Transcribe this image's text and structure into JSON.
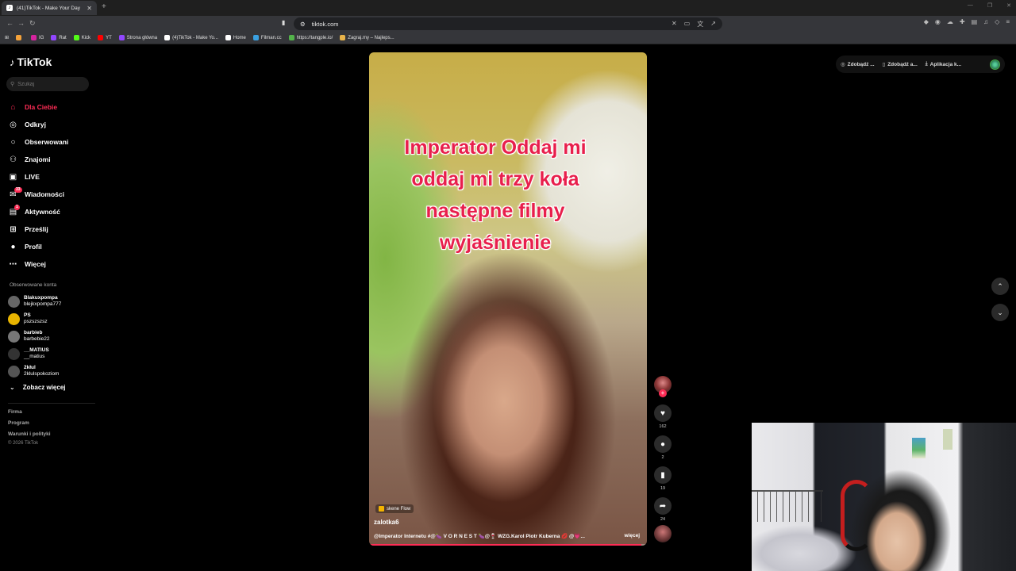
{
  "browser": {
    "tab_title": "(41)TikTok - Make Your Day",
    "url": "tiktok.com",
    "bookmarks": [
      {
        "label": "",
        "color": "#f4a23a"
      },
      {
        "label": "IG",
        "color": "#d6249f"
      },
      {
        "label": "Rat",
        "color": "#9146ff"
      },
      {
        "label": "Kick",
        "color": "#53fc18"
      },
      {
        "label": "YT",
        "color": "#ff0000"
      },
      {
        "label": "Strona główna",
        "color": "#9146ff"
      },
      {
        "label": "(4)TikTok - Make Yo...",
        "color": "#ffffff"
      },
      {
        "label": "Home",
        "color": "#ffffff"
      },
      {
        "label": "Filman.cc",
        "color": "#3aa0e0"
      },
      {
        "label": "https://tangple.io/",
        "color": "#53b34a"
      },
      {
        "label": "Zagraj.my – Najleps...",
        "color": "#e8b34a"
      }
    ]
  },
  "tiktok": {
    "logo": "TikTok",
    "search_placeholder": "Szukaj",
    "nav": [
      {
        "label": "Dla Ciebie",
        "icon": "home-icon",
        "glyph": "⌂",
        "active": true,
        "badge": ""
      },
      {
        "label": "Odkryj",
        "icon": "compass-icon",
        "glyph": "◎",
        "active": false,
        "badge": ""
      },
      {
        "label": "Obserwowani",
        "icon": "following-icon",
        "glyph": "○",
        "active": false,
        "badge": ""
      },
      {
        "label": "Znajomi",
        "icon": "friends-icon",
        "glyph": "⚇",
        "active": false,
        "badge": ""
      },
      {
        "label": "LIVE",
        "icon": "live-icon",
        "glyph": "▣",
        "active": false,
        "badge": ""
      },
      {
        "label": "Wiadomości",
        "icon": "messages-icon",
        "glyph": "✉",
        "active": false,
        "badge": "33"
      },
      {
        "label": "Aktywność",
        "icon": "activity-icon",
        "glyph": "▤",
        "active": false,
        "badge": "1"
      },
      {
        "label": "Prześlij",
        "icon": "upload-icon",
        "glyph": "⊞",
        "active": false,
        "badge": ""
      },
      {
        "label": "Profil",
        "icon": "profile-icon",
        "glyph": "●",
        "active": false,
        "badge": ""
      },
      {
        "label": "Więcej",
        "icon": "more-icon",
        "glyph": "⋯",
        "active": false,
        "badge": ""
      }
    ],
    "followed_title": "Obserwowane konta",
    "followed": [
      {
        "name": "Blakuxpompa",
        "handle": "blejkxpompa777"
      },
      {
        "name": "PS",
        "handle": "pszszszsz"
      },
      {
        "name": "barbieb",
        "handle": "barbebie22"
      },
      {
        "name": "__MATIUS",
        "handle": "__matius"
      },
      {
        "name": "2kłul",
        "handle": "2klulspokoziom"
      }
    ],
    "see_more": "Zobacz więcej",
    "footer": [
      "Firma",
      "Program",
      "Warunki i polityki"
    ],
    "copyright": "© 2026 TikTok",
    "header_buttons": [
      "Zdobądź ...",
      "Zdobądź a...",
      "Aplikacja k..."
    ]
  },
  "video": {
    "caption_lines": [
      "Imperator Oddaj mi",
      "oddaj mi trzy koła",
      "następne filmy",
      "wyjaśnienie"
    ],
    "effect": "skene Flow",
    "author": "zalotka6",
    "description": "@Imperator Internetu #@🍆 V O R N E S T 🍆@🍷 WZG.Karol Piotr Kuberna 💋 @💗...",
    "more": "więcej",
    "progress": 0.98,
    "likes": "162",
    "comments": "2",
    "saves": "19",
    "shares": "24"
  }
}
